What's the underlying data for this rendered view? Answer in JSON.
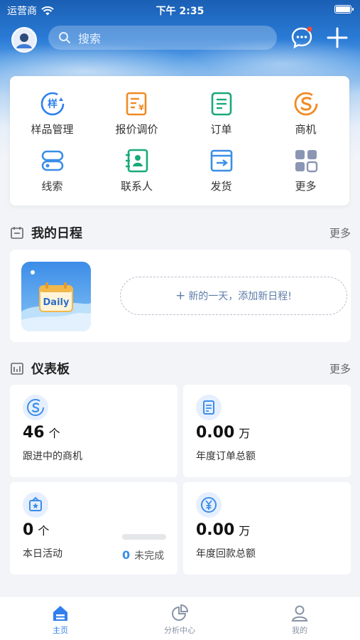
{
  "status_bar": {
    "carrier": "运营商",
    "time": "下午 2:35"
  },
  "header": {
    "search_placeholder": "搜索"
  },
  "quick_menu": [
    {
      "label": "样品管理",
      "icon": "sample-icon",
      "glyph": "样"
    },
    {
      "label": "报价调价",
      "icon": "quote-icon",
      "glyph": "¥"
    },
    {
      "label": "订单",
      "icon": "order-icon"
    },
    {
      "label": "商机",
      "icon": "opportunity-icon"
    },
    {
      "label": "线索",
      "icon": "clue-icon"
    },
    {
      "label": "联系人",
      "icon": "contact-icon"
    },
    {
      "label": "发货",
      "icon": "shipment-icon"
    },
    {
      "label": "更多",
      "icon": "grid-icon"
    }
  ],
  "schedule": {
    "title": "我的日程",
    "more": "更多",
    "image_text": "Daily",
    "add_prefix": "+",
    "add_text": "新的一天，添加新日程!"
  },
  "dashboard": {
    "title": "仪表板",
    "more": "更多",
    "cards": [
      {
        "value": "46",
        "unit": "个",
        "caption": "跟进中的商机",
        "icon": "opportunity-icon"
      },
      {
        "value": "0.00",
        "unit": "万",
        "caption": "年度订单总额",
        "icon": "order-icon"
      },
      {
        "value": "0",
        "unit": "个",
        "caption": "本日活动",
        "icon": "activity-icon"
      },
      {
        "value": "0.00",
        "unit": "万",
        "caption": "年度回款总额",
        "icon": "payment-icon"
      }
    ],
    "activity_undone_count": "0",
    "activity_undone_label": "未完成",
    "activity_progress": 0
  },
  "tabbar": [
    {
      "label": "主页",
      "icon": "home-icon",
      "active": true
    },
    {
      "label": "分析中心",
      "icon": "pie-chart-icon",
      "active": false
    },
    {
      "label": "我的",
      "icon": "user-icon",
      "active": false
    }
  ],
  "colors": {
    "primary": "#2f80ed",
    "orange": "#f08a24",
    "green": "#19a97b",
    "blue": "#3a8ee8"
  }
}
